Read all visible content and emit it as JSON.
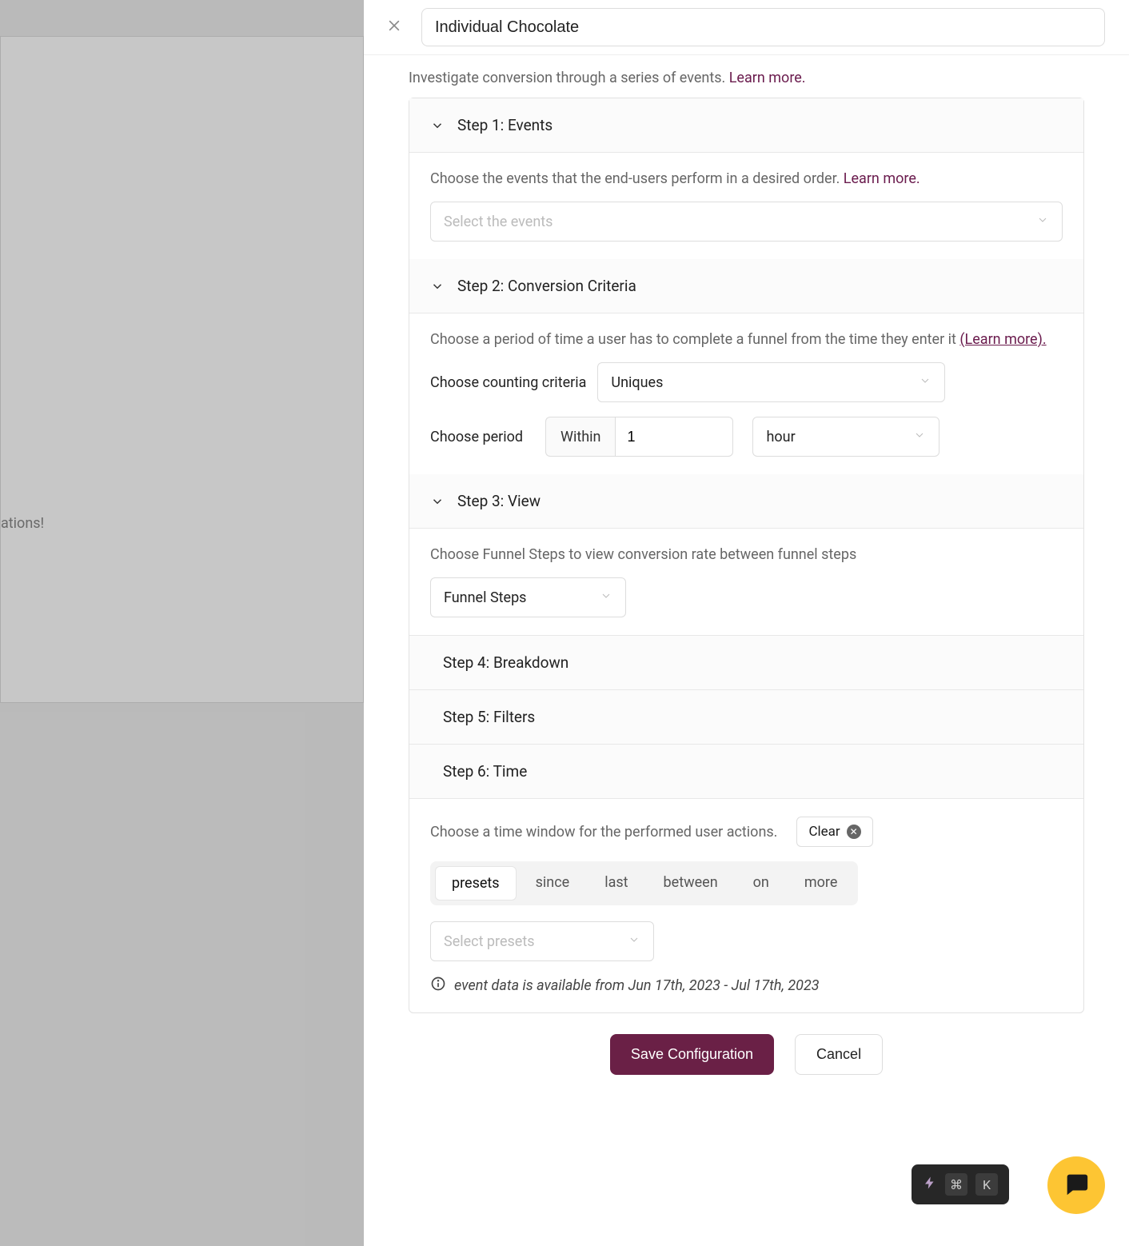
{
  "background": {
    "partial_text": "ations!"
  },
  "header": {
    "title_value": "Individual Chocolate"
  },
  "intro": {
    "text": "Investigate conversion through a series of events. ",
    "learn_more": "Learn more."
  },
  "steps": {
    "s1": {
      "title": "Step 1: Events",
      "desc": "Choose the events that the end-users perform in a desired order. ",
      "learn_more": "Learn more.",
      "select_placeholder": "Select the events"
    },
    "s2": {
      "title": "Step 2: Conversion Criteria",
      "desc": "Choose a period of time a user has to complete a funnel from the time they enter it ",
      "learn_more": "(Learn more).",
      "criteria_label": "Choose counting criteria",
      "criteria_value": "Uniques",
      "period_label": "Choose period",
      "period_prefix": "Within",
      "period_value": "1",
      "period_unit": "hour"
    },
    "s3": {
      "title": "Step 3: View",
      "desc": "Choose Funnel Steps to view conversion rate between funnel steps",
      "view_value": "Funnel Steps"
    },
    "s4": {
      "title": "Step 4: Breakdown"
    },
    "s5": {
      "title": "Step 5: Filters"
    },
    "s6": {
      "title": "Step 6: Time",
      "desc": "Choose a time window for the performed user actions.",
      "clear_label": "Clear",
      "tabs": {
        "presets": "presets",
        "since": "since",
        "last": "last",
        "between": "between",
        "on": "on",
        "more": "more"
      },
      "presets_placeholder": "Select presets",
      "info": "event data is available from Jun 17th, 2023 - Jul 17th, 2023"
    }
  },
  "footer": {
    "save": "Save Configuration",
    "cancel": "Cancel"
  },
  "cmd": {
    "key1": "⌘",
    "key2": "K"
  }
}
